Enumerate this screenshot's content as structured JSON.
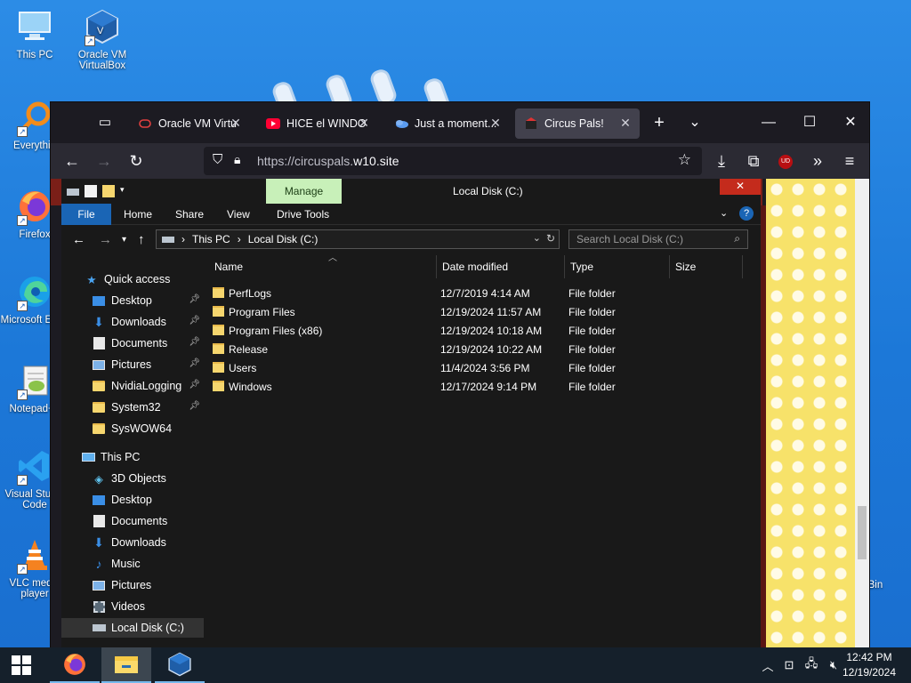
{
  "desktop": {
    "icons": [
      {
        "label": "This PC"
      },
      {
        "label": "Oracle VM VirtualBox"
      },
      {
        "label": "Everythin"
      },
      {
        "label": "Firefox"
      },
      {
        "label": "Microsoft Edge"
      },
      {
        "label": "Notepad++"
      },
      {
        "label": "Visual Studio Code"
      },
      {
        "label": "VLC media player"
      }
    ],
    "recycle_label": "e Bin"
  },
  "firefox": {
    "tabs": [
      {
        "title": "Oracle VM Virtu",
        "icon": "virtualbox-icon"
      },
      {
        "title": "HICE el WINDO",
        "icon": "youtube-icon"
      },
      {
        "title": "Just a moment...",
        "icon": "cloudflare-icon"
      },
      {
        "title": "Circus Pals!",
        "icon": "circus-icon"
      }
    ],
    "active_tab": 3,
    "new_tab": "+",
    "list_tabs": "⌄",
    "url_prefix": "https://circuspals.",
    "url_domain": "w10.site",
    "extension_badge": "UD"
  },
  "explorer": {
    "title": "Local Disk (C:)",
    "manage_label": "Manage",
    "close_glyph": "✕",
    "ribbon_tabs": [
      "File",
      "Home",
      "Share",
      "View",
      "Drive Tools"
    ],
    "breadcrumb": [
      "This PC",
      "Local Disk (C:)"
    ],
    "search_placeholder": "Search Local Disk (C:)",
    "columns": {
      "name": "Name",
      "date": "Date modified",
      "type": "Type",
      "size": "Size"
    },
    "files": [
      {
        "name": "PerfLogs",
        "date": "12/7/2019 4:14 AM",
        "type": "File folder"
      },
      {
        "name": "Program Files",
        "date": "12/19/2024 11:57 AM",
        "type": "File folder"
      },
      {
        "name": "Program Files (x86)",
        "date": "12/19/2024 10:18 AM",
        "type": "File folder"
      },
      {
        "name": "Release",
        "date": "12/19/2024 10:22 AM",
        "type": "File folder"
      },
      {
        "name": "Users",
        "date": "11/4/2024 3:56 PM",
        "type": "File folder"
      },
      {
        "name": "Windows",
        "date": "12/17/2024 9:14 PM",
        "type": "File folder"
      }
    ],
    "nav": {
      "quick_access": "Quick access",
      "quick_items": [
        "Desktop",
        "Downloads",
        "Documents",
        "Pictures",
        "NvidiaLogging",
        "System32",
        "SysWOW64"
      ],
      "this_pc": "This PC",
      "pc_items": [
        "3D Objects",
        "Desktop",
        "Documents",
        "Downloads",
        "Music",
        "Pictures",
        "Videos",
        "Local Disk (C:)"
      ]
    }
  },
  "taskbar": {
    "time": "12:42 PM",
    "date": "12/19/2024"
  },
  "colors": {
    "desktop_blue": "#1c78d8",
    "firefox_dark": "#1c1b22",
    "file_tab_blue": "#1a65b5",
    "manage_green": "#c8f0b9",
    "folder_yellow": "#f6d66e",
    "close_red": "#c42b1c"
  }
}
